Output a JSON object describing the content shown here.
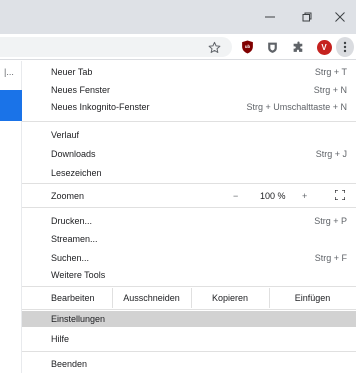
{
  "window": {
    "minimize_icon": "minimize-icon",
    "maximize_icon": "maximize-icon",
    "close_icon": "close-icon"
  },
  "toolbar": {
    "icons": [
      "star-icon",
      "ublock-icon",
      "shield-extension-icon",
      "puzzle-icon",
      "avatar",
      "kebab-menu-icon"
    ],
    "avatar_letter": "V",
    "avatar_color": "#c5221f"
  },
  "page": {
    "left_text": "|..."
  },
  "menu": {
    "new_tab": {
      "label": "Neuer Tab",
      "shortcut": "Strg + T"
    },
    "new_window": {
      "label": "Neues Fenster",
      "shortcut": "Strg + N"
    },
    "incognito": {
      "label": "Neues Inkognito-Fenster",
      "shortcut": "Strg + Umschalttaste + N"
    },
    "history": {
      "label": "Verlauf"
    },
    "downloads": {
      "label": "Downloads",
      "shortcut": "Strg + J"
    },
    "bookmarks": {
      "label": "Lesezeichen"
    },
    "zoom": {
      "label": "Zoomen",
      "minus": "−",
      "value": "100 %",
      "plus": "+"
    },
    "print": {
      "label": "Drucken...",
      "shortcut": "Strg + P"
    },
    "cast": {
      "label": "Streamen..."
    },
    "find": {
      "label": "Suchen...",
      "shortcut": "Strg + F"
    },
    "more_tools": {
      "label": "Weitere Tools"
    },
    "edit": {
      "label": "Bearbeiten",
      "cut": "Ausschneiden",
      "copy": "Kopieren",
      "paste": "Einfügen"
    },
    "settings": {
      "label": "Einstellungen"
    },
    "help": {
      "label": "Hilfe"
    },
    "quit": {
      "label": "Beenden"
    }
  },
  "colors": {
    "highlight": "#d2d2d2",
    "titlebar": "#dee1e6",
    "accent_blue": "#1a73e8",
    "ublock_red": "#c5221f"
  }
}
